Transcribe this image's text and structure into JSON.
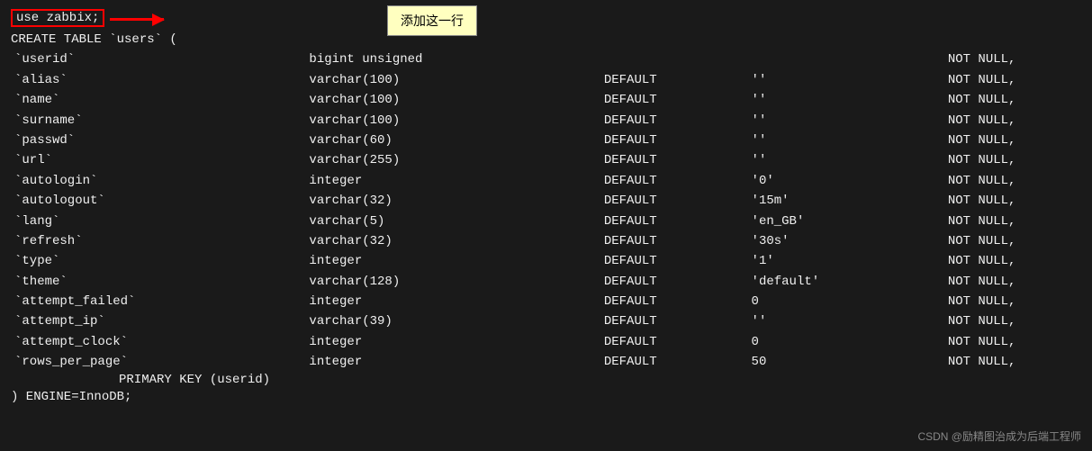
{
  "header": {
    "use_statement": "use zabbix;",
    "create_statement": "CREATE TABLE `users` (",
    "tooltip_text": "添加这一行",
    "arrow_label": "←"
  },
  "watermark": {
    "text": "CSDN @励精图治成为后端工程师"
  },
  "fields": [
    {
      "name": "`userid`",
      "type": "bigint unsigned",
      "default_kw": "",
      "default_val": "",
      "notnull": "NOT NULL,"
    },
    {
      "name": "`alias`",
      "type": "varchar(100)",
      "default_kw": "DEFAULT",
      "default_val": "''",
      "notnull": "NOT NULL,"
    },
    {
      "name": "`name`",
      "type": "varchar(100)",
      "default_kw": "DEFAULT",
      "default_val": "''",
      "notnull": "NOT NULL,"
    },
    {
      "name": "`surname`",
      "type": "varchar(100)",
      "default_kw": "DEFAULT",
      "default_val": "''",
      "notnull": "NOT NULL,"
    },
    {
      "name": "`passwd`",
      "type": "varchar(60)",
      "default_kw": "DEFAULT",
      "default_val": "''",
      "notnull": "NOT NULL,"
    },
    {
      "name": "`url`",
      "type": "varchar(255)",
      "default_kw": "DEFAULT",
      "default_val": "''",
      "notnull": "NOT NULL,"
    },
    {
      "name": "`autologin`",
      "type": "integer",
      "default_kw": "DEFAULT",
      "default_val": "'0'",
      "notnull": "NOT NULL,"
    },
    {
      "name": "`autologout`",
      "type": "varchar(32)",
      "default_kw": "DEFAULT",
      "default_val": "'15m'",
      "notnull": "NOT NULL,"
    },
    {
      "name": "`lang`",
      "type": "varchar(5)",
      "default_kw": "DEFAULT",
      "default_val": "'en_GB'",
      "notnull": "NOT NULL,"
    },
    {
      "name": "`refresh`",
      "type": "varchar(32)",
      "default_kw": "DEFAULT",
      "default_val": "'30s'",
      "notnull": "NOT NULL,"
    },
    {
      "name": "`type`",
      "type": "integer",
      "default_kw": "DEFAULT",
      "default_val": "'1'",
      "notnull": "NOT NULL,"
    },
    {
      "name": "`theme`",
      "type": "varchar(128)",
      "default_kw": "DEFAULT",
      "default_val": "'default'",
      "notnull": "NOT NULL,"
    },
    {
      "name": "`attempt_failed`",
      "type": "integer",
      "default_kw": "DEFAULT",
      "default_val": "0",
      "notnull": "NOT NULL,"
    },
    {
      "name": "`attempt_ip`",
      "type": "varchar(39)",
      "default_kw": "DEFAULT",
      "default_val": "''",
      "notnull": "NOT NULL,"
    },
    {
      "name": "`attempt_clock`",
      "type": "integer",
      "default_kw": "DEFAULT",
      "default_val": "0",
      "notnull": "NOT NULL,"
    },
    {
      "name": "`rows_per_page`",
      "type": "integer",
      "default_kw": "DEFAULT",
      "default_val": "50",
      "notnull": "NOT NULL,"
    }
  ],
  "footer": {
    "primary_key": "PRIMARY KEY (userid)",
    "closing": ") ENGINE=InnoDB;"
  }
}
